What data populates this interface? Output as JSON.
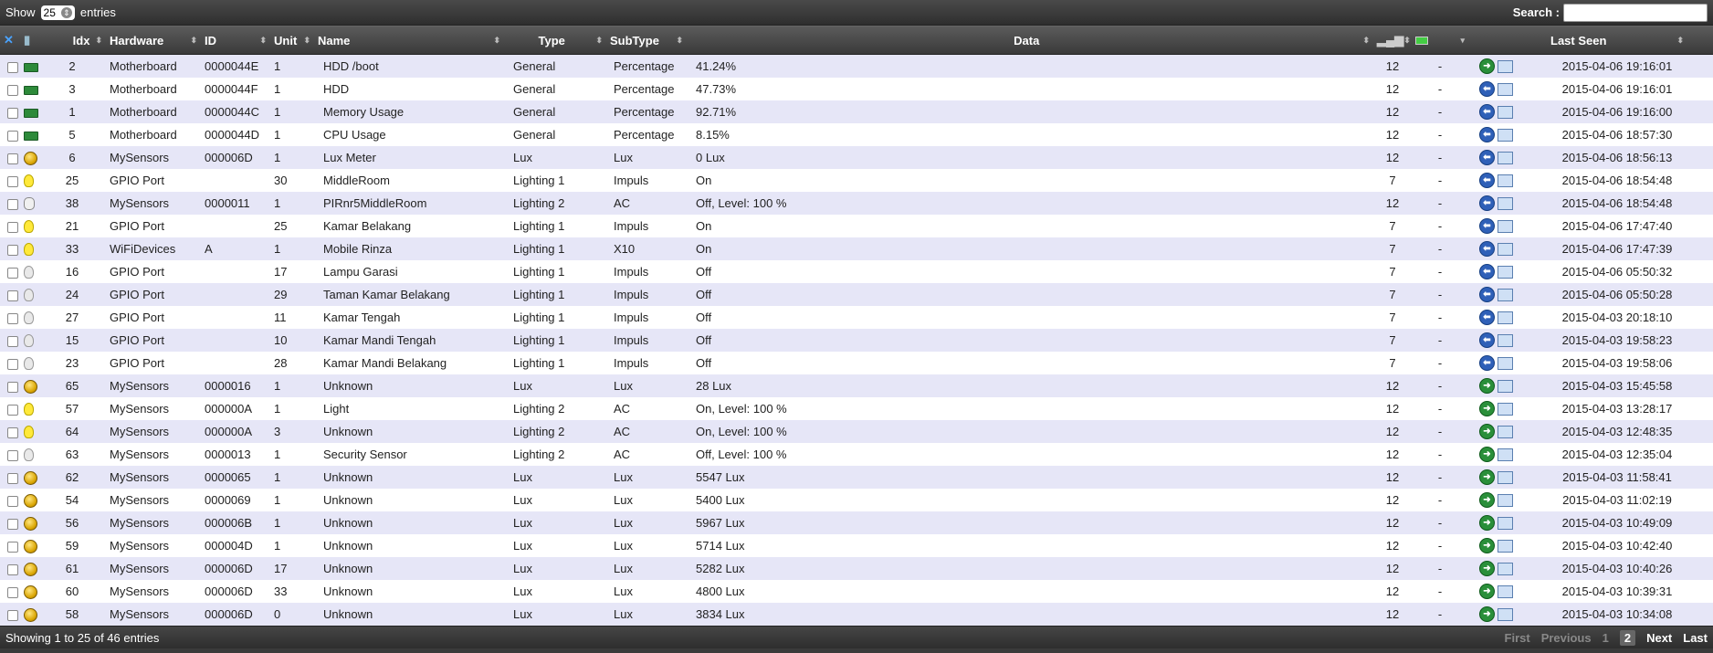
{
  "length_menu": {
    "prefix": "Show",
    "value": "25",
    "suffix": "entries"
  },
  "search": {
    "label": "Search :",
    "value": ""
  },
  "columns": {
    "idx": "Idx",
    "hardware": "Hardware",
    "id": "ID",
    "unit": "Unit",
    "name": "Name",
    "type": "Type",
    "subtype": "SubType",
    "data": "Data",
    "last_seen": "Last Seen"
  },
  "rows": [
    {
      "icon": "board",
      "idx": "2",
      "hardware": "Motherboard",
      "id": "0000044E",
      "unit": "1",
      "name": "HDD /boot",
      "type": "General",
      "subtype": "Percentage",
      "data": "41.24%",
      "signal": "12",
      "battery": "-",
      "action": "green",
      "last_seen": "2015-04-06 19:16:01"
    },
    {
      "icon": "board",
      "idx": "3",
      "hardware": "Motherboard",
      "id": "0000044F",
      "unit": "1",
      "name": "HDD",
      "type": "General",
      "subtype": "Percentage",
      "data": "47.73%",
      "signal": "12",
      "battery": "-",
      "action": "blue",
      "last_seen": "2015-04-06 19:16:01"
    },
    {
      "icon": "board",
      "idx": "1",
      "hardware": "Motherboard",
      "id": "0000044C",
      "unit": "1",
      "name": "Memory Usage",
      "type": "General",
      "subtype": "Percentage",
      "data": "92.71%",
      "signal": "12",
      "battery": "-",
      "action": "blue",
      "last_seen": "2015-04-06 19:16:00"
    },
    {
      "icon": "board",
      "idx": "5",
      "hardware": "Motherboard",
      "id": "0000044D",
      "unit": "1",
      "name": "CPU Usage",
      "type": "General",
      "subtype": "Percentage",
      "data": "8.15%",
      "signal": "12",
      "battery": "-",
      "action": "blue",
      "last_seen": "2015-04-06 18:57:30"
    },
    {
      "icon": "lux",
      "idx": "6",
      "hardware": "MySensors",
      "id": "000006D",
      "unit": "1",
      "name": "Lux Meter",
      "type": "Lux",
      "subtype": "Lux",
      "data": "0 Lux",
      "signal": "12",
      "battery": "-",
      "action": "blue",
      "last_seen": "2015-04-06 18:56:13"
    },
    {
      "icon": "bulb-on",
      "idx": "25",
      "hardware": "GPIO Port",
      "id": "",
      "unit": "30",
      "name": "MiddleRoom",
      "type": "Lighting 1",
      "subtype": "Impuls",
      "data": "On",
      "signal": "7",
      "battery": "-",
      "action": "blue",
      "last_seen": "2015-04-06 18:54:48"
    },
    {
      "icon": "pir",
      "idx": "38",
      "hardware": "MySensors",
      "id": "0000011",
      "unit": "1",
      "name": "PIRnr5MiddleRoom",
      "type": "Lighting 2",
      "subtype": "AC",
      "data": "Off, Level: 100 %",
      "signal": "12",
      "battery": "-",
      "action": "blue",
      "last_seen": "2015-04-06 18:54:48"
    },
    {
      "icon": "bulb-on",
      "idx": "21",
      "hardware": "GPIO Port",
      "id": "",
      "unit": "25",
      "name": "Kamar Belakang",
      "type": "Lighting 1",
      "subtype": "Impuls",
      "data": "On",
      "signal": "7",
      "battery": "-",
      "action": "blue",
      "last_seen": "2015-04-06 17:47:40"
    },
    {
      "icon": "bulb-on",
      "idx": "33",
      "hardware": "WiFiDevices",
      "id": "A",
      "unit": "1",
      "name": "Mobile Rinza",
      "type": "Lighting 1",
      "subtype": "X10",
      "data": "On",
      "signal": "7",
      "battery": "-",
      "action": "blue",
      "last_seen": "2015-04-06 17:47:39"
    },
    {
      "icon": "bulb-off",
      "idx": "16",
      "hardware": "GPIO Port",
      "id": "",
      "unit": "17",
      "name": "Lampu Garasi",
      "type": "Lighting 1",
      "subtype": "Impuls",
      "data": "Off",
      "signal": "7",
      "battery": "-",
      "action": "blue",
      "last_seen": "2015-04-06 05:50:32"
    },
    {
      "icon": "bulb-off",
      "idx": "24",
      "hardware": "GPIO Port",
      "id": "",
      "unit": "29",
      "name": "Taman Kamar Belakang",
      "type": "Lighting 1",
      "subtype": "Impuls",
      "data": "Off",
      "signal": "7",
      "battery": "-",
      "action": "blue",
      "last_seen": "2015-04-06 05:50:28"
    },
    {
      "icon": "bulb-off",
      "idx": "27",
      "hardware": "GPIO Port",
      "id": "",
      "unit": "11",
      "name": "Kamar Tengah",
      "type": "Lighting 1",
      "subtype": "Impuls",
      "data": "Off",
      "signal": "7",
      "battery": "-",
      "action": "blue",
      "last_seen": "2015-04-03 20:18:10"
    },
    {
      "icon": "bulb-off",
      "idx": "15",
      "hardware": "GPIO Port",
      "id": "",
      "unit": "10",
      "name": "Kamar Mandi Tengah",
      "type": "Lighting 1",
      "subtype": "Impuls",
      "data": "Off",
      "signal": "7",
      "battery": "-",
      "action": "blue",
      "last_seen": "2015-04-03 19:58:23"
    },
    {
      "icon": "bulb-off",
      "idx": "23",
      "hardware": "GPIO Port",
      "id": "",
      "unit": "28",
      "name": "Kamar Mandi Belakang",
      "type": "Lighting 1",
      "subtype": "Impuls",
      "data": "Off",
      "signal": "7",
      "battery": "-",
      "action": "blue",
      "last_seen": "2015-04-03 19:58:06"
    },
    {
      "icon": "lux",
      "idx": "65",
      "hardware": "MySensors",
      "id": "0000016",
      "unit": "1",
      "name": "Unknown",
      "type": "Lux",
      "subtype": "Lux",
      "data": "28 Lux",
      "signal": "12",
      "battery": "-",
      "action": "green",
      "last_seen": "2015-04-03 15:45:58"
    },
    {
      "icon": "bulb-on",
      "idx": "57",
      "hardware": "MySensors",
      "id": "000000A",
      "unit": "1",
      "name": "Light",
      "type": "Lighting 2",
      "subtype": "AC",
      "data": "On, Level: 100 %",
      "signal": "12",
      "battery": "-",
      "action": "green",
      "last_seen": "2015-04-03 13:28:17"
    },
    {
      "icon": "bulb-on",
      "idx": "64",
      "hardware": "MySensors",
      "id": "000000A",
      "unit": "3",
      "name": "Unknown",
      "type": "Lighting 2",
      "subtype": "AC",
      "data": "On, Level: 100 %",
      "signal": "12",
      "battery": "-",
      "action": "green",
      "last_seen": "2015-04-03 12:48:35"
    },
    {
      "icon": "bulb-off",
      "idx": "63",
      "hardware": "MySensors",
      "id": "0000013",
      "unit": "1",
      "name": "Security Sensor",
      "type": "Lighting 2",
      "subtype": "AC",
      "data": "Off, Level: 100 %",
      "signal": "12",
      "battery": "-",
      "action": "green",
      "last_seen": "2015-04-03 12:35:04"
    },
    {
      "icon": "lux",
      "idx": "62",
      "hardware": "MySensors",
      "id": "0000065",
      "unit": "1",
      "name": "Unknown",
      "type": "Lux",
      "subtype": "Lux",
      "data": "5547 Lux",
      "signal": "12",
      "battery": "-",
      "action": "green",
      "last_seen": "2015-04-03 11:58:41"
    },
    {
      "icon": "lux",
      "idx": "54",
      "hardware": "MySensors",
      "id": "0000069",
      "unit": "1",
      "name": "Unknown",
      "type": "Lux",
      "subtype": "Lux",
      "data": "5400 Lux",
      "signal": "12",
      "battery": "-",
      "action": "green",
      "last_seen": "2015-04-03 11:02:19"
    },
    {
      "icon": "lux",
      "idx": "56",
      "hardware": "MySensors",
      "id": "000006B",
      "unit": "1",
      "name": "Unknown",
      "type": "Lux",
      "subtype": "Lux",
      "data": "5967 Lux",
      "signal": "12",
      "battery": "-",
      "action": "green",
      "last_seen": "2015-04-03 10:49:09"
    },
    {
      "icon": "lux",
      "idx": "59",
      "hardware": "MySensors",
      "id": "000004D",
      "unit": "1",
      "name": "Unknown",
      "type": "Lux",
      "subtype": "Lux",
      "data": "5714 Lux",
      "signal": "12",
      "battery": "-",
      "action": "green",
      "last_seen": "2015-04-03 10:42:40"
    },
    {
      "icon": "lux",
      "idx": "61",
      "hardware": "MySensors",
      "id": "000006D",
      "unit": "17",
      "name": "Unknown",
      "type": "Lux",
      "subtype": "Lux",
      "data": "5282 Lux",
      "signal": "12",
      "battery": "-",
      "action": "green",
      "last_seen": "2015-04-03 10:40:26"
    },
    {
      "icon": "lux",
      "idx": "60",
      "hardware": "MySensors",
      "id": "000006D",
      "unit": "33",
      "name": "Unknown",
      "type": "Lux",
      "subtype": "Lux",
      "data": "4800 Lux",
      "signal": "12",
      "battery": "-",
      "action": "green",
      "last_seen": "2015-04-03 10:39:31"
    },
    {
      "icon": "lux",
      "idx": "58",
      "hardware": "MySensors",
      "id": "000006D",
      "unit": "0",
      "name": "Unknown",
      "type": "Lux",
      "subtype": "Lux",
      "data": "3834 Lux",
      "signal": "12",
      "battery": "-",
      "action": "green",
      "last_seen": "2015-04-03 10:34:08"
    }
  ],
  "info": "Showing 1 to 25 of 46 entries",
  "pager": {
    "first": "First",
    "previous": "Previous",
    "page1": "1",
    "page2": "2",
    "next": "Next",
    "last": "Last"
  }
}
